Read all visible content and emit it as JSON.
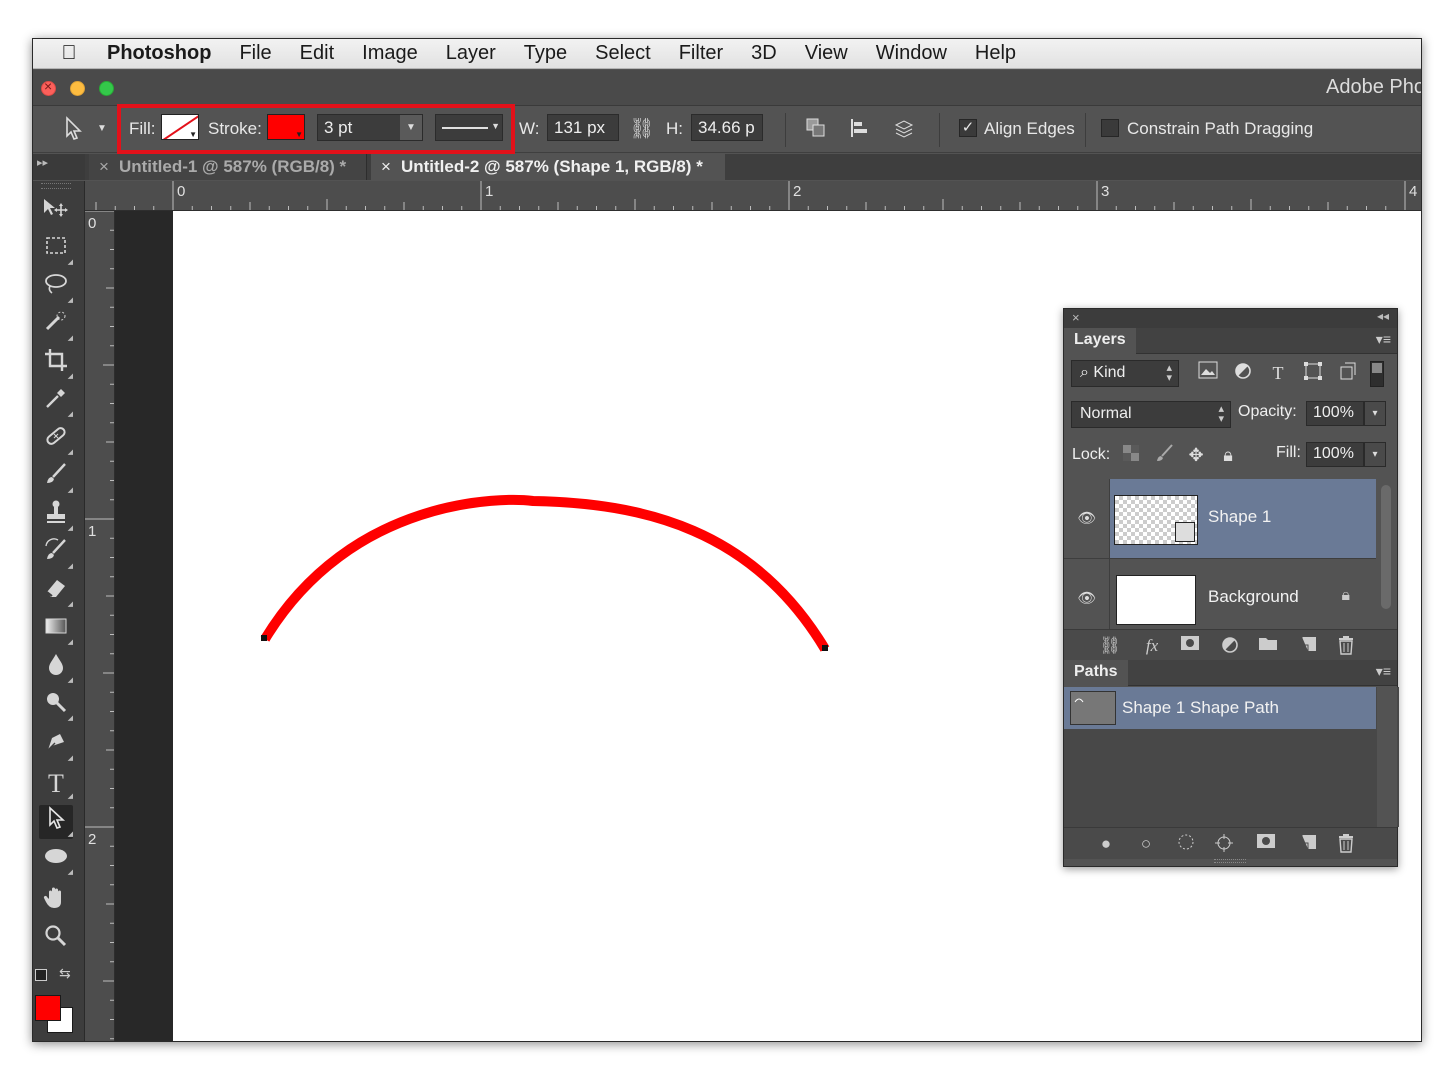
{
  "menubar": {
    "apple_icon": "apple-icon",
    "items": [
      "Photoshop",
      "File",
      "Edit",
      "Image",
      "Layer",
      "Type",
      "Select",
      "Filter",
      "3D",
      "View",
      "Window",
      "Help"
    ]
  },
  "titlebar": {
    "title": "Adobe Pho"
  },
  "options": {
    "fill_label": "Fill:",
    "stroke_label": "Stroke:",
    "stroke_color": "#ff0000",
    "stroke_width": "3 pt",
    "width_label": "W:",
    "width_value": "131 px",
    "height_label": "H:",
    "height_value": "34.66 p",
    "align_edges": "Align Edges",
    "align_edges_checked": true,
    "constrain_path_dragging": "Constrain Path Dragging",
    "constrain_checked": false,
    "highlight_color": "#e3111a"
  },
  "tabs": [
    {
      "close": "×",
      "label": "Untitled-1 @ 587% (RGB/8) *",
      "active": false
    },
    {
      "close": "×",
      "label": "Untitled-2 @ 587% (Shape 1, RGB/8) *",
      "active": true
    }
  ],
  "rulers": {
    "top": [
      "0",
      "1",
      "2",
      "3",
      "4"
    ],
    "left": [
      "0",
      "1",
      "2"
    ]
  },
  "toolbox": {
    "foreground_color": "#ff0000",
    "background_color": "#ffffff"
  },
  "layers_panel": {
    "title": "Layers",
    "filter_kind": "Kind",
    "blend_mode": "Normal",
    "opacity_label": "Opacity:",
    "opacity_value": "100%",
    "lock_label": "Lock:",
    "fill_label": "Fill:",
    "fill_value": "100%",
    "layers": [
      {
        "name": "Shape 1",
        "selected": true,
        "locked": false
      },
      {
        "name": "Background",
        "selected": false,
        "locked": true
      }
    ],
    "footer_fx": "fx"
  },
  "paths_panel": {
    "title": "Paths",
    "paths": [
      {
        "name": "Shape 1 Shape Path",
        "selected": true
      }
    ]
  },
  "canvas": {
    "arc_stroke_color": "#ff0000"
  }
}
